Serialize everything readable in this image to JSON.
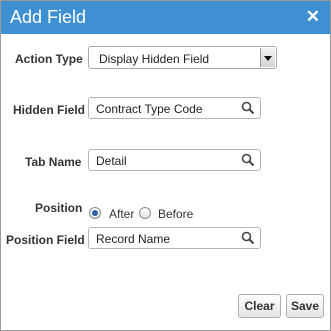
{
  "dialog": {
    "title": "Add Field",
    "close_symbol": "✕"
  },
  "form": {
    "action_type": {
      "label": "Action Type",
      "value": "Display Hidden Field"
    },
    "hidden_field": {
      "label": "Hidden Field",
      "value": "Contract Type Code",
      "icon": "search-icon"
    },
    "tab_name": {
      "label": "Tab Name",
      "value": "Detail",
      "icon": "search-icon"
    },
    "position": {
      "label": "Position",
      "options": [
        "After",
        "Before"
      ],
      "selected": "After"
    },
    "position_field": {
      "label": "Position Field",
      "value": "Record Name",
      "icon": "search-icon"
    }
  },
  "buttons": {
    "clear": "Clear",
    "save": "Save"
  },
  "colors": {
    "titlebar": "#3f8fd3",
    "radio_selected": "#2f5fa8"
  }
}
